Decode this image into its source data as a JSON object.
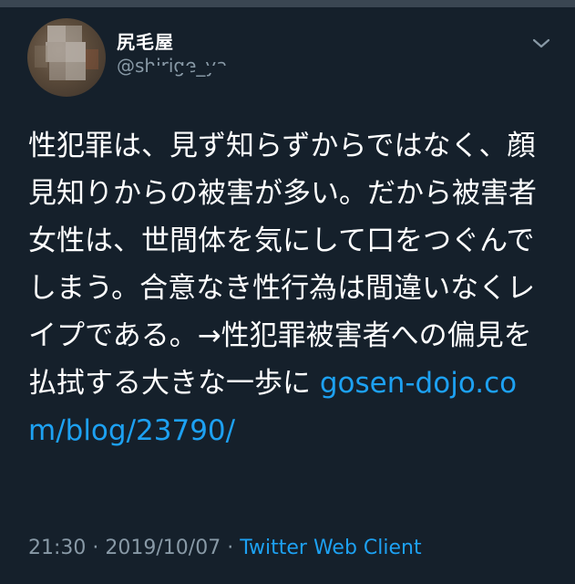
{
  "tweet": {
    "display_name": "尻毛屋",
    "handle": "@shirige_ya",
    "text": "性犯罪は、見ず知らずからではなく、顔見知りからの被害が多い。だから被害者女性は、世間体を気にして口をつぐんでしまう。合意なき性行為は間違いなくレイプである。→性犯罪被害者への偏見を払拭する大きな一歩に",
    "link": "gosen-dojo.com/blog/23790/",
    "time": "21:30",
    "date": "2019/10/07",
    "separator": "·",
    "client": "Twitter Web Client"
  },
  "icons": {
    "menu": "chevron-down-icon",
    "avatar": "avatar"
  },
  "colors": {
    "background": "#15202b",
    "text": "#ffffff",
    "muted": "#8899a6",
    "link": "#1da1f2"
  }
}
